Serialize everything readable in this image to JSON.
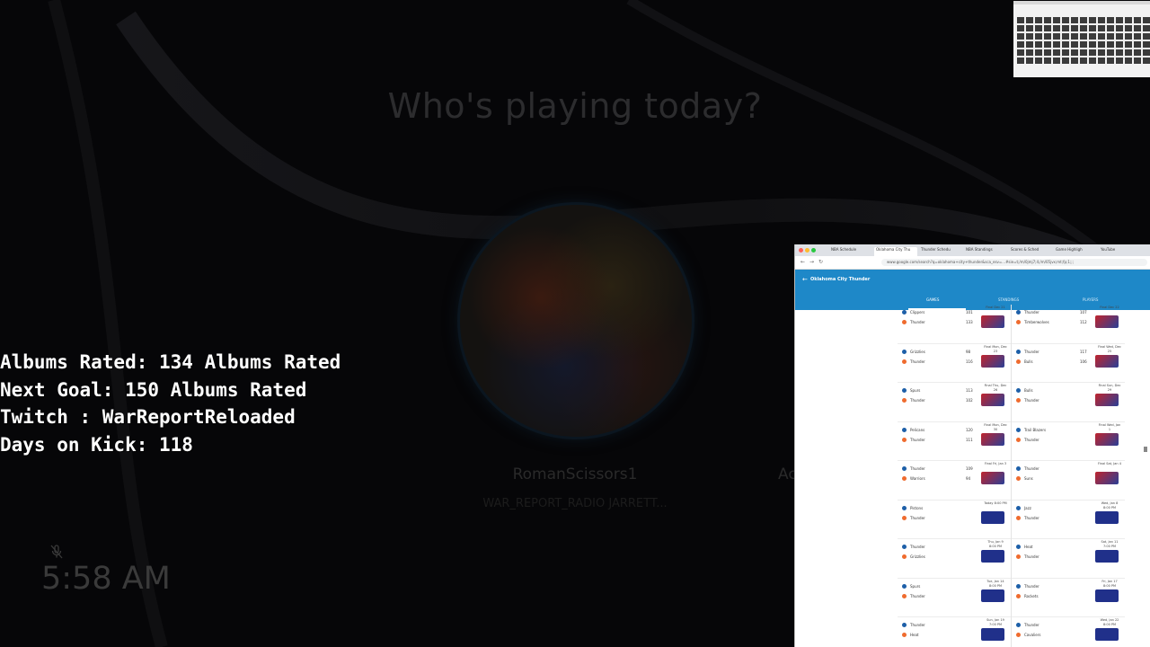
{
  "console": {
    "title": "Who's playing today?",
    "profile_name": "RomanScissors1",
    "profile_subtitle": "WAR_REPORT_RADIO JARRETT...",
    "next_profile_partial": "Ac",
    "clock": "5:58 AM",
    "mic_state": "muted"
  },
  "stream_overlay": {
    "lines": [
      "Albums Rated: 134 Albums Rated",
      "Next Goal: 150 Albums Rated",
      "Twitch : WarReportReloaded",
      "Days on Kick: 118"
    ]
  },
  "browser": {
    "tabs": [
      "NBA Schedule",
      "Oklahoma City Thu",
      "Thunder Schedu",
      "NBA Standings",
      "Scores & Sched",
      "Game Highligh",
      "YouTube"
    ],
    "url": "www.google.com/search?q=oklahoma+city+thunder&sca_esv=...#sie=t;/m/0jmj7;4;/m/05jvx;mt;fp;1;;;",
    "team_title": "Oklahoma City Thunder",
    "subtabs": [
      "Games",
      "Standings",
      "Players"
    ],
    "active_subtab": "Games",
    "games_left": [
      {
        "t1": "Clippers",
        "t2": "Thunder",
        "s1": "101",
        "s2": "133",
        "status": "Final Dec 21"
      },
      {
        "t1": "Grizzlies",
        "t2": "Thunder",
        "s1": "98",
        "s2": "116",
        "status": "Final Mon, Dec 23"
      },
      {
        "t1": "Spurs",
        "t2": "Thunder",
        "s1": "113",
        "s2": "102",
        "status": "Final Thu, Dec 26"
      },
      {
        "t1": "Pelicans",
        "t2": "Thunder",
        "s1": "120",
        "s2": "111",
        "status": "Final Mon, Dec 30"
      },
      {
        "t1": "Thunder",
        "t2": "Warriors",
        "s1": "109",
        "s2": "94",
        "status": "Final Fri, Jan 3"
      },
      {
        "t1": "Pistons",
        "t2": "Thunder",
        "s1": "",
        "s2": "",
        "status": "Today 8:00 PM"
      },
      {
        "t1": "Thunder",
        "t2": "Grizzlies",
        "s1": "",
        "s2": "",
        "status": "Thu, Jan 9 8:00 PM"
      },
      {
        "t1": "Spurs",
        "t2": "Thunder",
        "s1": "",
        "s2": "",
        "status": "Tue, Jan 14 8:00 PM"
      },
      {
        "t1": "Thunder",
        "t2": "Heat",
        "s1": "",
        "s2": "",
        "status": "Sun, Jan 19 7:00 PM"
      }
    ],
    "games_right": [
      {
        "t1": "Thunder",
        "t2": "Timberwolves",
        "s1": "107",
        "s2": "112",
        "status": "Final Dec 22"
      },
      {
        "t1": "Thunder",
        "t2": "Bulls",
        "s1": "117",
        "s2": "106",
        "status": "Final Wed, Dec 25"
      },
      {
        "t1": "Bulls",
        "t2": "Thunder",
        "s1": "",
        "s2": "",
        "status": "Final Sun, Dec 29"
      },
      {
        "t1": "Trail Blazers",
        "t2": "Thunder",
        "s1": "",
        "s2": "",
        "status": "Final Wed, Jan 1"
      },
      {
        "t1": "Thunder",
        "t2": "Suns",
        "s1": "",
        "s2": "",
        "status": "Final Sat, Jan 4"
      },
      {
        "t1": "Jazz",
        "t2": "Thunder",
        "s1": "",
        "s2": "",
        "status": "Wed, Jan 8 8:00 PM"
      },
      {
        "t1": "Heat",
        "t2": "Thunder",
        "s1": "",
        "s2": "",
        "status": "Sat, Jan 11 7:00 PM"
      },
      {
        "t1": "Thunder",
        "t2": "Rockets",
        "s1": "",
        "s2": "",
        "status": "Fri, Jan 17 8:00 PM"
      },
      {
        "t1": "Thunder",
        "t2": "Cavaliers",
        "s1": "",
        "s2": "",
        "status": "Wed, Jan 22 8:00 PM"
      }
    ]
  },
  "colors": {
    "header_blue": "#1e88c8",
    "overlay_text": "#ffffff"
  }
}
